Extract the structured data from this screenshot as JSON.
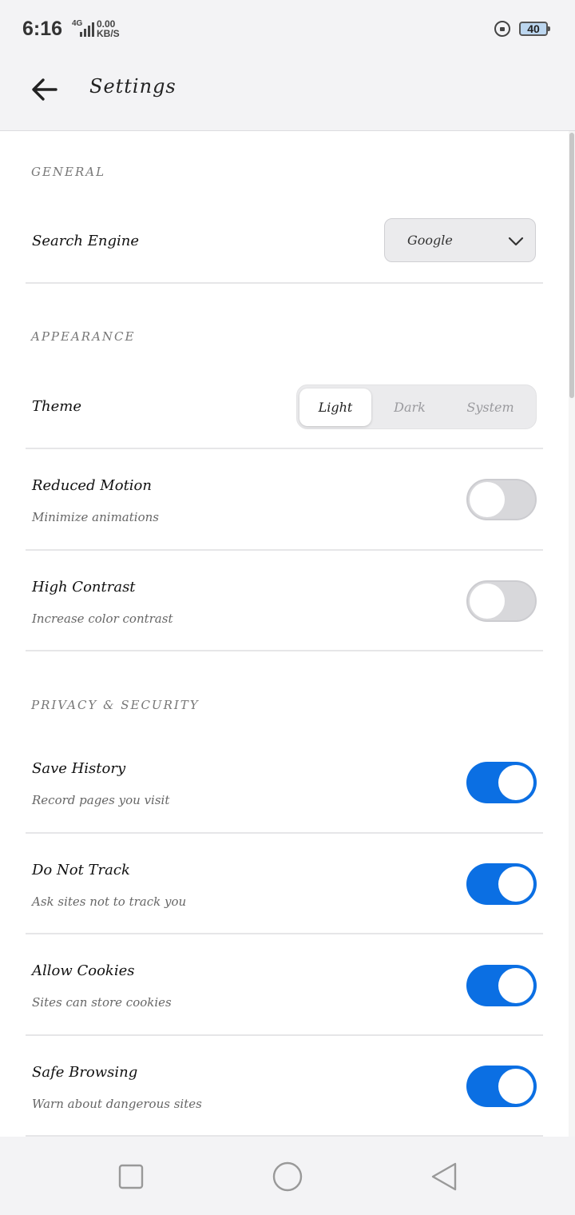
{
  "status_bar": {
    "time": "6:16",
    "network": "4G",
    "speed_value": "0.00",
    "speed_unit": "KB/S",
    "battery": "40"
  },
  "header": {
    "title": "Settings",
    "back_icon": "arrow-left-icon"
  },
  "sections": {
    "general": {
      "title": "GENERAL",
      "search_engine": {
        "label": "Search Engine",
        "value": "Google"
      }
    },
    "appearance": {
      "title": "APPEARANCE",
      "theme": {
        "label": "Theme",
        "options": [
          "Light",
          "Dark",
          "System"
        ],
        "selected": "Light"
      },
      "reduced_motion": {
        "label": "Reduced Motion",
        "description": "Minimize animations",
        "enabled": false
      },
      "high_contrast": {
        "label": "High Contrast",
        "description": "Increase color contrast",
        "enabled": false
      }
    },
    "privacy": {
      "title": "PRIVACY & SECURITY",
      "save_history": {
        "label": "Save History",
        "description": "Record pages you visit",
        "enabled": true
      },
      "do_not_track": {
        "label": "Do Not Track",
        "description": "Ask sites not to track you",
        "enabled": true
      },
      "allow_cookies": {
        "label": "Allow Cookies",
        "description": "Sites can store cookies",
        "enabled": true
      },
      "safe_browsing": {
        "label": "Safe Browsing",
        "description": "Warn about dangerous sites",
        "enabled": true
      }
    }
  },
  "colors": {
    "accent": "#0b6fe3",
    "toggle_off": "#d8d8db",
    "background": "#ffffff",
    "chrome": "#f3f3f5"
  },
  "nav_bar": {
    "icons": [
      "square-recents-icon",
      "circle-home-icon",
      "triangle-back-icon"
    ]
  }
}
